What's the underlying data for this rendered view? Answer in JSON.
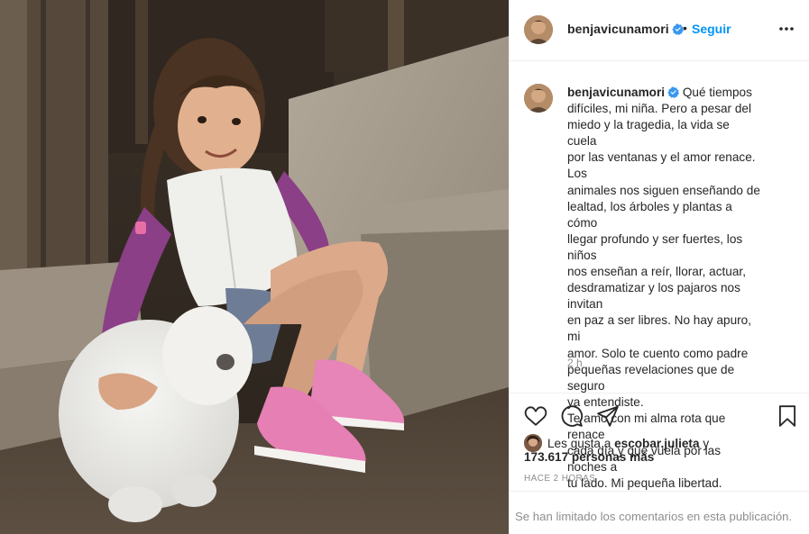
{
  "post": {
    "image_alt": "",
    "header": {
      "username": "benjavicunamori",
      "separator": "•",
      "follow_label": "Seguir"
    },
    "caption": {
      "username": "benjavicunamori",
      "text": "Qué tiempos\ndifíciles, mi niña. Pero a pesar del\nmiedo y la tragedia, la vida se cuela\npor las ventanas y el amor renace. Los\nanimales nos siguen enseñando de\nlealtad, los árboles y plantas a cómo\nllegar profundo y ser fuertes, los niños\nnos enseñan a reír, llorar, actuar,\ndesdramatizar y los pajaros nos invitan\nen paz a ser libres. No hay apuro, mi\namor. Solo te cuento como padre\npequeñas revelaciones que de seguro\nya entendiste.\nTe amo con mi alma rota que renace\ncada día y que vuela por las noches a\ntu lado. Mi pequeña libertad.",
      "time_ago": "2 h"
    },
    "likes": {
      "prefix": "Les gusta a",
      "liker": "escobar.julieta",
      "joiner": "y",
      "others": "173.617 personas más"
    },
    "posted_label": "HACE 2 HORAS",
    "comments_notice": "Se han limitado los comentarios en esta publicación.",
    "icons": {
      "like": "heart-icon",
      "comment": "comment-icon",
      "share": "paper-plane-icon",
      "save": "bookmark-icon",
      "more": "more-options-icon",
      "verified": "verified-badge-icon"
    },
    "colors": {
      "link_blue": "#0095f6",
      "verified_blue": "#3897f0",
      "text": "#262626",
      "muted": "#8e8e8e",
      "border": "#efefef"
    }
  }
}
